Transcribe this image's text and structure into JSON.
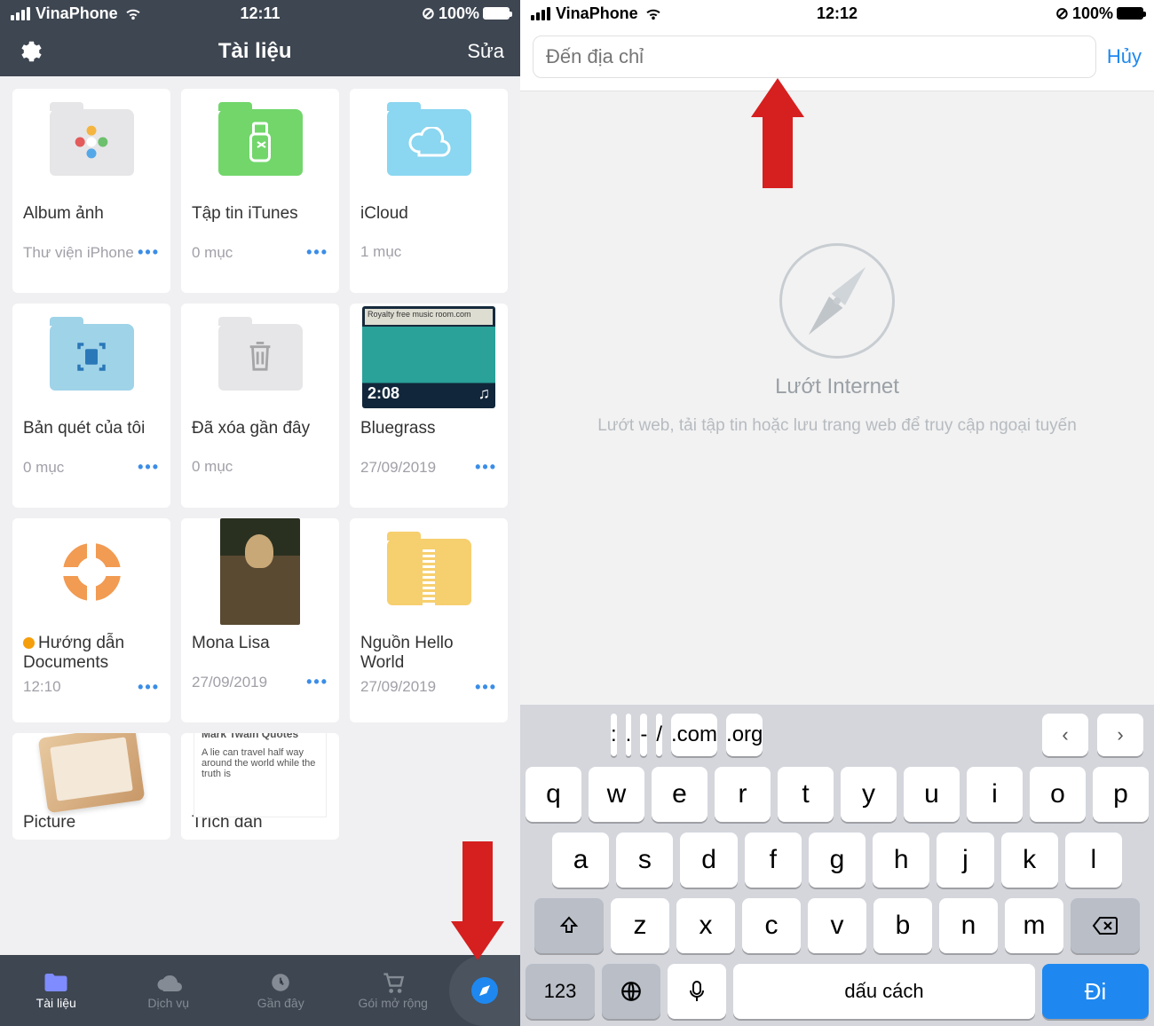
{
  "left": {
    "status": {
      "carrier": "VinaPhone",
      "time": "12:11",
      "battery": "100%"
    },
    "header": {
      "title": "Tài liệu",
      "edit": "Sửa"
    },
    "tiles": [
      {
        "title": "Album ảnh",
        "sub": "Thư viện iPhone",
        "dots": true
      },
      {
        "title": "Tập tin iTunes",
        "sub": "0 mục",
        "dots": true
      },
      {
        "title": "iCloud",
        "sub": "1 mục",
        "dots": false
      },
      {
        "title": "Bản quét của tôi",
        "sub": "0 mục",
        "dots": true
      },
      {
        "title": "Đã xóa gần đây",
        "sub": "0 mục",
        "dots": false
      },
      {
        "title": "Bluegrass",
        "sub": "27/09/2019",
        "dots": true,
        "video_time": "2:08",
        "video_label": "Royalty free music room.com"
      },
      {
        "title": "Hướng dẫn Documents",
        "sub": "12:10",
        "dots": true,
        "orange": true
      },
      {
        "title": "Mona Lisa",
        "sub": "27/09/2019",
        "dots": true
      },
      {
        "title": "Nguồn Hello World",
        "sub": "27/09/2019",
        "dots": true
      },
      {
        "title": "Picture",
        "sub": ""
      },
      {
        "title": "Trích dẫn",
        "sub": "",
        "quote_h": "Mark Twain Quotes",
        "quote_b": "A lie can travel half way around the world while the truth is"
      }
    ],
    "tabs": [
      {
        "label": "Tài liệu"
      },
      {
        "label": "Dịch vụ"
      },
      {
        "label": "Gần đây"
      },
      {
        "label": "Gói mở rộng"
      }
    ]
  },
  "right": {
    "status": {
      "carrier": "VinaPhone",
      "time": "12:12",
      "battery": "100%"
    },
    "address_placeholder": "Đến địa chỉ",
    "cancel": "Hủy",
    "body_title": "Lướt Internet",
    "body_sub": "Lướt web, tải tập tin hoặc lưu trang web để truy cập ngoại tuyến",
    "kb": {
      "acc": [
        ":",
        ".",
        "-",
        "/",
        ".com",
        ".org"
      ],
      "row1": [
        "q",
        "w",
        "e",
        "r",
        "t",
        "y",
        "u",
        "i",
        "o",
        "p"
      ],
      "row2": [
        "a",
        "s",
        "d",
        "f",
        "g",
        "h",
        "j",
        "k",
        "l"
      ],
      "row3": [
        "z",
        "x",
        "c",
        "v",
        "b",
        "n",
        "m"
      ],
      "numkey": "123",
      "space": "dấu cách",
      "go": "Đi"
    }
  }
}
